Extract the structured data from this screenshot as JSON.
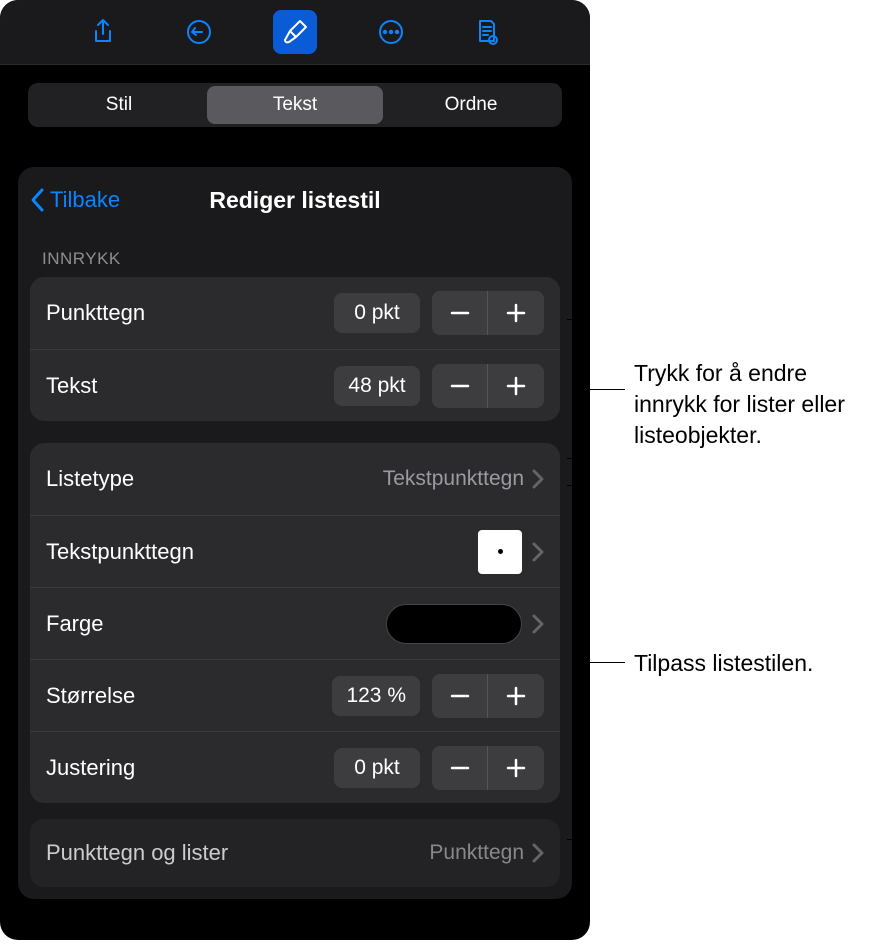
{
  "toolbar": {
    "share": "share-icon",
    "undo": "undo-icon",
    "format": "format-brush-icon",
    "more": "more-icon",
    "doc": "doc-icon"
  },
  "tabs": {
    "style": "Stil",
    "text": "Tekst",
    "arrange": "Ordne"
  },
  "header": {
    "back": "Tilbake",
    "title": "Rediger listestil"
  },
  "indent": {
    "section_label": "INNRYKK",
    "bullet_label": "Punkttegn",
    "bullet_value": "0 pkt",
    "text_label": "Tekst",
    "text_value": "48 pkt"
  },
  "style": {
    "listtype_label": "Listetype",
    "listtype_value": "Tekstpunkttegn",
    "textbullet_label": "Tekstpunkttegn",
    "color_label": "Farge",
    "size_label": "Størrelse",
    "size_value": "123 %",
    "align_label": "Justering",
    "align_value": "0 pkt"
  },
  "bottom": {
    "label": "Punkttegn og lister",
    "value": "Punkttegn"
  },
  "callouts": {
    "indent": "Trykk for å endre innrykk for lister eller listeobjekter.",
    "customize": "Tilpass listestilen."
  }
}
